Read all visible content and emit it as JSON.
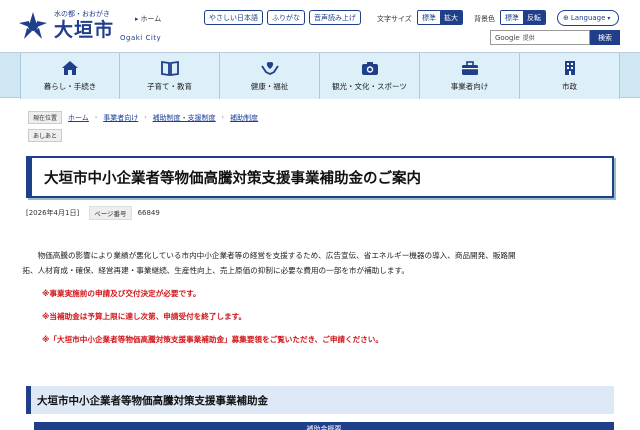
{
  "header": {
    "tagline": "水の都・おおがき",
    "city_name": "大垣市",
    "city_name_en": "Ogaki City",
    "home_label": "ホーム",
    "util_buttons": [
      "やさしい日本語",
      "ふりがな",
      "音声読み上げ"
    ],
    "font_size_label": "文字サイズ",
    "font_size_options": [
      "標準",
      "拡大"
    ],
    "bg_color_label": "背景色",
    "bg_color_options": [
      "標準",
      "反転"
    ],
    "language_label": "Language",
    "search_brand": "Google",
    "search_placeholder": "提供",
    "search_button": "検索"
  },
  "gnav": [
    {
      "label": "暮らし・手続き",
      "icon": "house-icon"
    },
    {
      "label": "子育て・教育",
      "icon": "book-icon"
    },
    {
      "label": "健康・福祉",
      "icon": "hands-heart-icon"
    },
    {
      "label": "観光・文化・スポーツ",
      "icon": "camera-icon"
    },
    {
      "label": "事業者向け",
      "icon": "briefcase-icon"
    },
    {
      "label": "市政",
      "icon": "building-icon"
    }
  ],
  "breadcrumb": {
    "label": "現在位置",
    "items": [
      "ホーム",
      "事業者向け",
      "補助制度・支援制度",
      "補助制度"
    ],
    "tag": "あしあと"
  },
  "page": {
    "title": "大垣市中小企業者等物価高騰対策支援事業補助金のご案内",
    "date": "[2026年4月1日]",
    "page_id_label": "ページ番号",
    "page_id": "66849",
    "intro_line1": "物価高騰の影響により業績が悪化している市内中小企業者等の経営を支援するため、広告宣伝、省エネルギー機器の導入、商品開発、販路開",
    "intro_line2": "拓、人材育成・確保、経営再建・事業継続、生産性向上、売上原価の抑制に必要な費用の一部を市が補助します。",
    "notices": [
      "※事業実施前の申請及び交付決定が必要です。",
      "※当補助金は予算上限に達し次第、申請受付を終了します。",
      "※「大垣市中小企業者等物価高騰対策支援事業補助金」募集要領をご覧いただき、ご申請ください。"
    ],
    "section_title": "大垣市中小企業者等物価高騰対策支援事業補助金",
    "table_header": "補助金概要"
  },
  "colors": {
    "brand": "#1f3f8a",
    "nav_bg": "#ddeff8",
    "notice": "#d0171c"
  }
}
